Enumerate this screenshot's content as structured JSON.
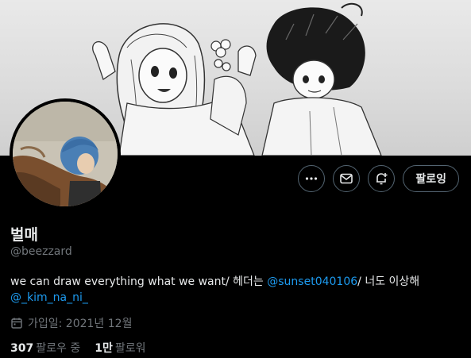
{
  "profile": {
    "name": "벌매",
    "handle": "@beezzard",
    "bio": {
      "text1": "we can draw everything what we want/ 헤더는 ",
      "mention1": "@sunset040106",
      "text2": "/ 너도 이상해",
      "mention2": "@_kim_na_ni_"
    },
    "joined": "가입일: 2021년 12월",
    "following": {
      "count": "307",
      "label": "팔로우 중"
    },
    "followers": {
      "count": "1만",
      "label": "팔로워"
    }
  },
  "actions": {
    "follow_label": "팔로잉"
  },
  "icons": {
    "more": "more-icon",
    "message": "mail-icon",
    "notify": "bell-plus-icon",
    "calendar": "calendar-icon"
  },
  "colors": {
    "background": "#000000",
    "text": "#e7e9ea",
    "muted": "#71767b",
    "link": "#1d9bf0",
    "border": "#536471"
  }
}
